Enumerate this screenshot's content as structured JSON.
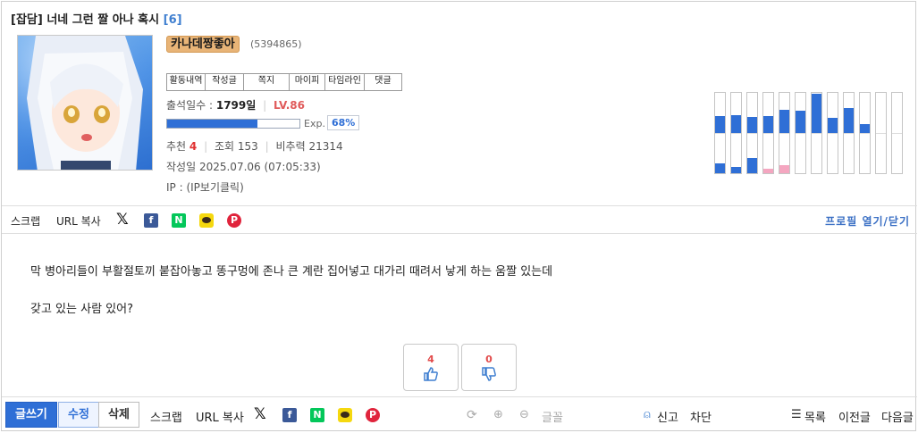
{
  "post": {
    "category": "[잡담]",
    "title": "너네 그런 짤 아나 혹시",
    "comment_count": "[6]"
  },
  "author": {
    "nickname": "카나데짱좋아",
    "uid": "(5394865)",
    "tabs": [
      "활동내역",
      "작성글",
      "쪽지",
      "마이피",
      "타임라인",
      "댓글"
    ],
    "attendance_label": "출석일수 :",
    "attendance_value": "1799일",
    "level": "LV.86",
    "exp_label": "Exp.",
    "exp_percent": "68%",
    "exp_progress": 0.68,
    "recommend_label": "추천",
    "recommend_value": "4",
    "views_label": "조회",
    "views_value": "153",
    "nonrec_label": "비추력",
    "nonrec_value": "21314",
    "date_label": "작성일",
    "date_value": "2025.07.06 (07:05:33)",
    "ip_text": "IP : (IP보기클릭)"
  },
  "activity": {
    "up": [
      0.42,
      0.44,
      0.41,
      0.42,
      0.58,
      0.55,
      0.97,
      0.37,
      0.62,
      0.22,
      0,
      0
    ],
    "down": [
      0.24,
      0.16,
      0.37,
      0.1,
      0.21,
      0,
      0,
      0,
      0,
      0,
      0,
      0
    ],
    "up_color": "#2f6fd6",
    "down_color": "#2f6fd6",
    "down_alt_color": "#f4a6c0"
  },
  "share": {
    "scrap": "스크랩",
    "url_copy": "URL 복사",
    "profile_toggle": "프로필 열기/닫기"
  },
  "content": {
    "line1": "막 병아리들이 부활절토끼 붙잡아놓고 똥구멍에 존나 큰 계란 집어넣고 대가리 때려서 낳게 하는 움짤 있는데",
    "line2": "갖고 있는 사람 있어?"
  },
  "votes": {
    "up": "4",
    "down": "0"
  },
  "bottom": {
    "write": "글쓰기",
    "edit": "수정",
    "delete": "삭제",
    "scrap": "스크랩",
    "url_copy": "URL 복사",
    "font": "글꼴",
    "report": "신고",
    "block": "차단",
    "list": "목록",
    "prev": "이전글",
    "next": "다음글"
  }
}
